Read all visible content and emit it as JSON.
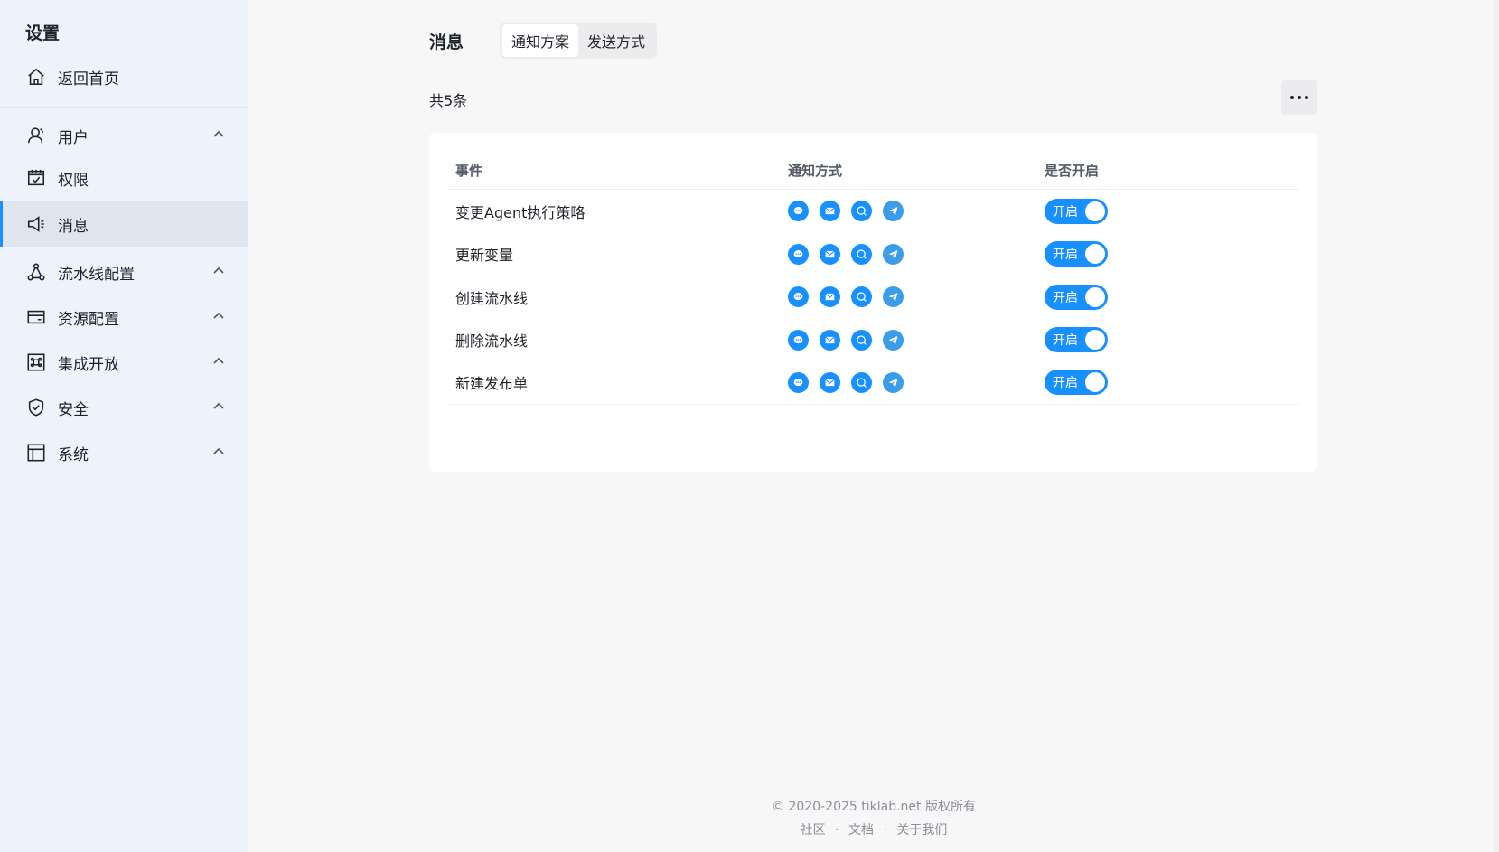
{
  "sidebar": {
    "title": "设置",
    "home_label": "返回首页",
    "items": [
      {
        "label": "用户",
        "icon": "user-icon",
        "expandable": true
      },
      {
        "label": "权限",
        "icon": "permission-icon",
        "expandable": false
      },
      {
        "label": "消息",
        "icon": "megaphone-icon",
        "expandable": false,
        "active": true
      },
      {
        "label": "流水线配置",
        "icon": "pipeline-icon",
        "expandable": true
      },
      {
        "label": "资源配置",
        "icon": "card-icon",
        "expandable": true
      },
      {
        "label": "集成开放",
        "icon": "command-icon",
        "expandable": true
      },
      {
        "label": "安全",
        "icon": "shield-icon",
        "expandable": true
      },
      {
        "label": "系统",
        "icon": "layout-icon",
        "expandable": true
      }
    ]
  },
  "header": {
    "title": "消息",
    "tabs": [
      {
        "label": "通知方案",
        "active": true
      },
      {
        "label": "发送方式",
        "active": false
      }
    ]
  },
  "count_label": "共5条",
  "table": {
    "columns": [
      "事件",
      "通知方式",
      "是否开启"
    ],
    "rows": [
      {
        "event": "变更Agent执行策略",
        "enabled_label": "开启"
      },
      {
        "event": "更新变量",
        "enabled_label": "开启"
      },
      {
        "event": "创建流水线",
        "enabled_label": "开启"
      },
      {
        "event": "删除流水线",
        "enabled_label": "开启"
      },
      {
        "event": "新建发布单",
        "enabled_label": "开启"
      }
    ],
    "method_icons": [
      "site-message-icon",
      "email-icon",
      "chat-icon",
      "telegram-icon"
    ]
  },
  "footer": {
    "copyright": "© 2020-2025 tiklab.net 版权所有",
    "links": [
      "社区",
      "文档",
      "关于我们"
    ],
    "separator": "·"
  },
  "colors": {
    "accent": "#1890ff",
    "sidebar_bg": "#eef2fa",
    "active_bg": "#dfe4ee"
  }
}
